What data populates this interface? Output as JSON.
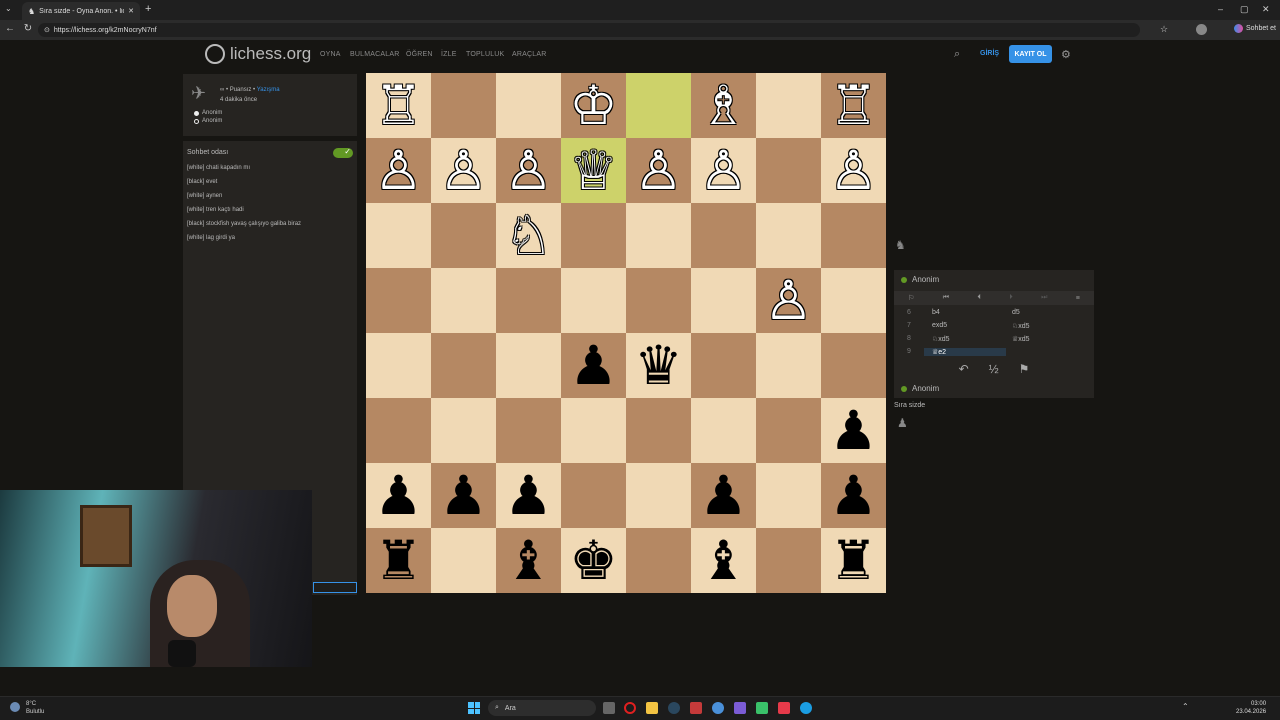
{
  "browser": {
    "tab_title": "Sıra sizde - Oyna Anon. • lichess.o",
    "url": "https://lichess.org/k2mNocryN7nf",
    "profile_label": "Sohbet et"
  },
  "header": {
    "logo": "lichess.org",
    "nav": [
      "OYNA",
      "BULMACALAR",
      "ÖĞREN",
      "İZLE",
      "TOPLULUK",
      "ARAÇLAR"
    ],
    "login": "GİRİŞ",
    "signup": "KAYIT OL"
  },
  "game_info": {
    "mode": "∞ • Puansız • ",
    "mode_link": "Yazışma",
    "time_ago": "4 dakika önce",
    "player_white": "Anonim",
    "player_black": "Anonim"
  },
  "chat": {
    "title": "Sohbet odası",
    "messages": [
      "[white] chati kapadın mı",
      "[black] evet",
      "[white] aynen",
      "[white] tren kaçtı hadi",
      "[black] stockfish yavaş çalışıyo galiba biraz",
      "[white] lag girdi ya"
    ]
  },
  "board": {
    "orientation": "black-bottom",
    "ranks": [
      [
        "wR",
        "",
        "",
        "wK",
        "",
        "wB",
        "",
        "wR"
      ],
      [
        "wP",
        "wP",
        "wP",
        "wQ",
        "wP",
        "wP",
        "",
        "wP"
      ],
      [
        "",
        "",
        "wN",
        "",
        "",
        "",
        "",
        ""
      ],
      [
        "",
        "",
        "",
        "",
        "",
        "",
        "wP",
        ""
      ],
      [
        "",
        "",
        "",
        "bP",
        "bQ",
        "",
        "",
        ""
      ],
      [
        "",
        "",
        "",
        "",
        "",
        "",
        "",
        "bP"
      ],
      [
        "bP",
        "bP",
        "bP",
        "",
        "",
        "bP",
        "",
        "bP"
      ],
      [
        "bR",
        "",
        "bB",
        "bK",
        "",
        "bB",
        "",
        "bR"
      ]
    ],
    "highlighted": [
      [
        0,
        4
      ],
      [
        1,
        3
      ]
    ]
  },
  "moves": {
    "top_player": "Anonim",
    "bottom_player": "Anonim",
    "rows": [
      {
        "n": "6",
        "w": "b4",
        "b": "d5"
      },
      {
        "n": "7",
        "w": "exd5",
        "b": "♘xd5"
      },
      {
        "n": "8",
        "w": "♘xd5",
        "b": "♕xd5"
      },
      {
        "n": "9",
        "w": "♕e2",
        "b": ""
      }
    ],
    "controls": [
      "⚐",
      "⏮",
      "⏴",
      "⏵",
      "⏭",
      "≡"
    ],
    "actions": [
      "↶",
      "½",
      "⚑"
    ],
    "turn_text": "Sıra sizde"
  },
  "taskbar": {
    "weather_temp": "8°C",
    "weather_desc": "Bulutlu",
    "search": "Ara",
    "time": "03:00",
    "date": "23.04.2026"
  },
  "icons": {
    "pieces": {
      "wK": "♔",
      "wQ": "♕",
      "wR": "♖",
      "wB": "♗",
      "wN": "♘",
      "wP": "♙",
      "bK": "♚",
      "bQ": "♛",
      "bR": "♜",
      "bB": "♝",
      "bN": "♞",
      "bP": "♟"
    }
  }
}
